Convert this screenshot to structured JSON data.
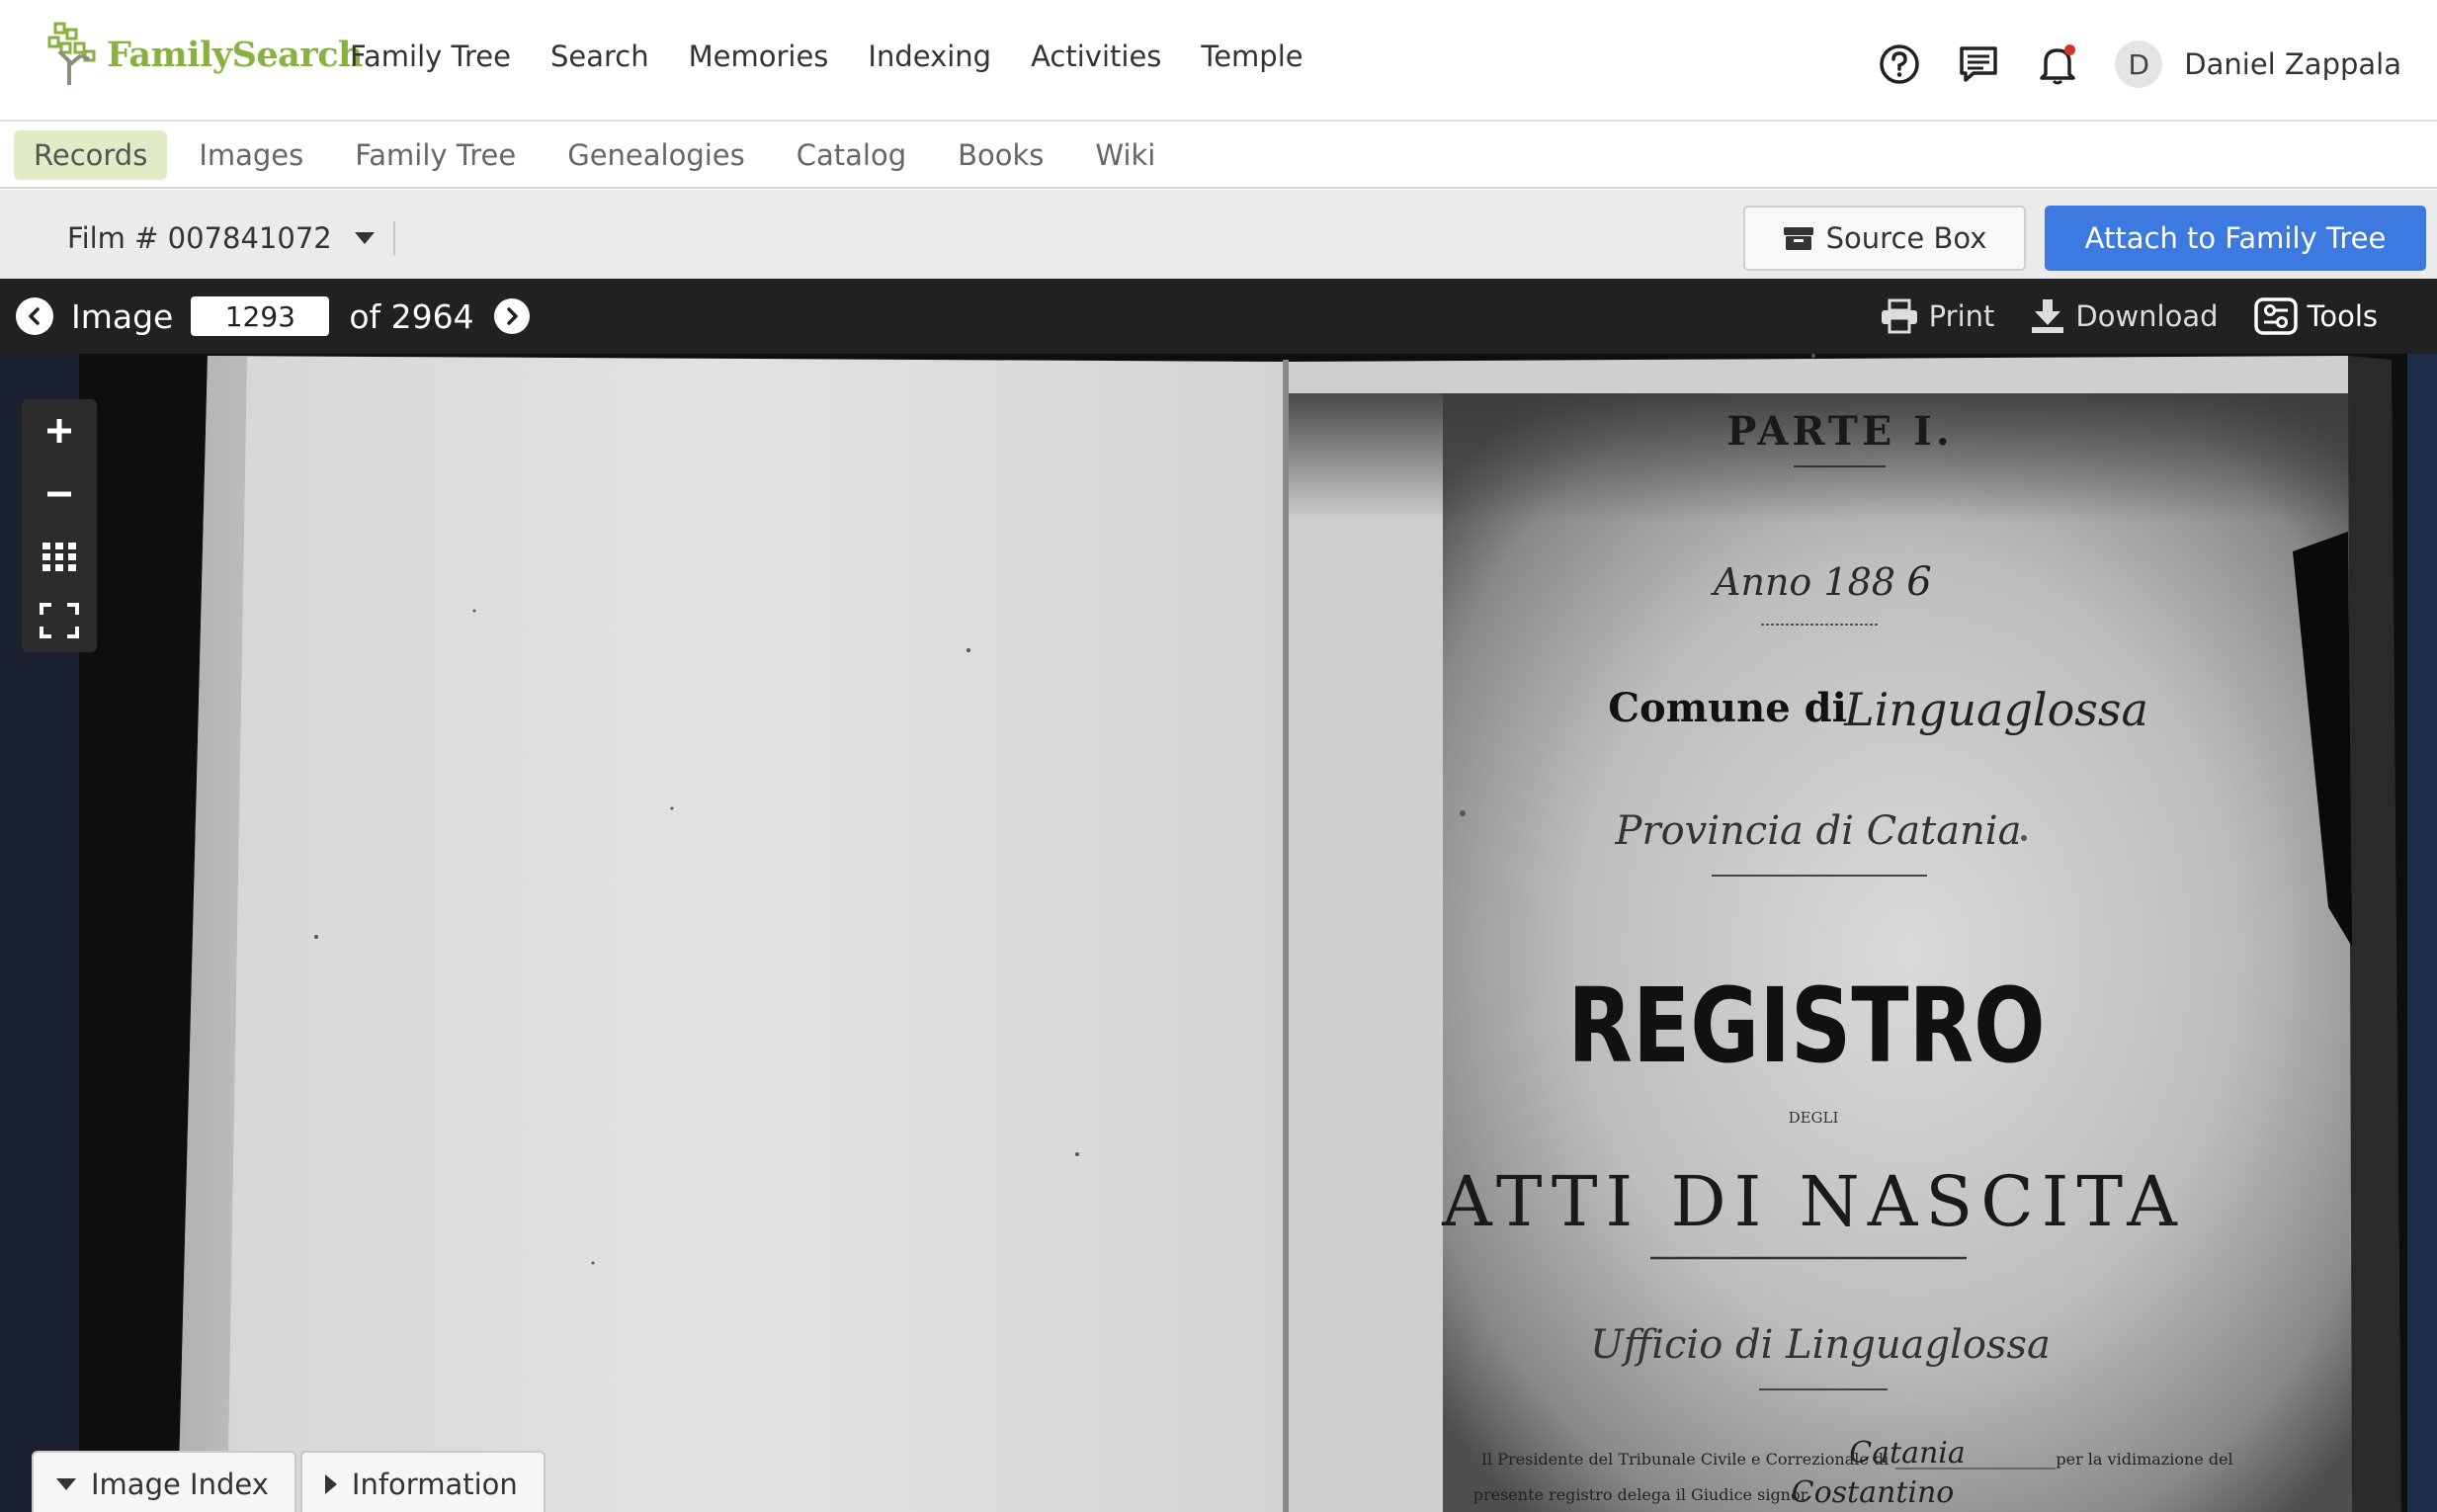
{
  "header": {
    "logo_text": "FamilySearch",
    "nav": [
      "Family Tree",
      "Search",
      "Memories",
      "Indexing",
      "Activities",
      "Temple"
    ],
    "icons": [
      "help-icon",
      "messages-icon",
      "notifications-icon"
    ],
    "avatar_initial": "D",
    "user_name": "Daniel Zappala"
  },
  "subnav": {
    "items": [
      "Records",
      "Images",
      "Family Tree",
      "Genealogies",
      "Catalog",
      "Books",
      "Wiki"
    ],
    "active": "Records"
  },
  "filmbar": {
    "film_label": "Film # 007841072",
    "source_box_label": "Source Box",
    "attach_label": "Attach to Family Tree"
  },
  "image_toolbar": {
    "image_label": "Image",
    "current_image": "1293",
    "of_label": "of 2964",
    "print_label": "Print",
    "download_label": "Download",
    "tools_label": "Tools"
  },
  "scan_text": {
    "parte": "PARTE I.",
    "anno": "Anno 188",
    "anno_hand": "6",
    "comune": "Comune di",
    "comune_hand": "Linguaglossa",
    "provincia_hand": "Provincia di Catania",
    "registro": "REGISTRO",
    "degli": "DEGLI",
    "atti": "ATTI DI NASCITA",
    "ufficio_hand": "Ufficio di Linguaglossa",
    "presidente": "Il Presidente del Tribunale Civile e Correzionale di",
    "presidente_hand": "Catania",
    "vidimazione": "per la vidimazione del",
    "presente": "presente registro delega il Giudice signor",
    "presente_hand": "Costantino"
  },
  "bottom_tabs": {
    "image_index_label": "Image Index",
    "information_label": "Information"
  },
  "colors": {
    "brand_green": "#87b23d",
    "primary_blue": "#3c79e0",
    "toolbar_dark": "#212121",
    "active_tab_bg": "#dfecc5"
  }
}
